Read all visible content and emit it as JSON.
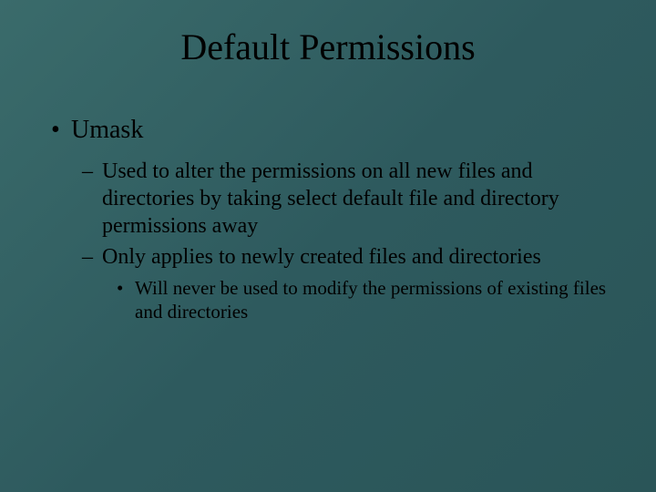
{
  "title": "Default Permissions",
  "bullets": {
    "l1_0": "Umask",
    "l2_0": "Used to alter the permissions on all new files and directories by taking select default file and directory permissions away",
    "l2_1": "Only applies to newly created files and directories",
    "l3_0": "Will never be used to modify the permissions of existing files and directories"
  }
}
